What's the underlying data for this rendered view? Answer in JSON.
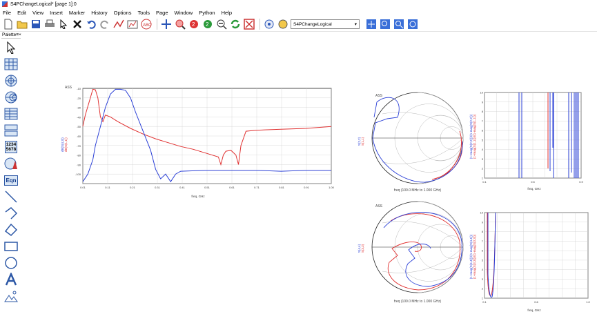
{
  "window": {
    "title": "S4PChangeLogical* [page 1]:0"
  },
  "menu": [
    "File",
    "Edit",
    "View",
    "Insert",
    "Marker",
    "History",
    "Options",
    "Tools",
    "Page",
    "Window",
    "Python",
    "Help"
  ],
  "toolbar": {
    "network_select": "S4PChangeLogical"
  },
  "palette": {
    "title": "Palette",
    "matrix_label_top": "1234",
    "matrix_label_bottom": "5678",
    "eqn_label": "Eqn"
  },
  "plots": {
    "rect1": {
      "ylabel_red": "dB(S(1,1))",
      "ylabel_blue": "dB(S(4,3))",
      "xlabel": "freq, GHz",
      "y_top": "-10",
      "y_ticks": [
        "-10",
        "-20",
        "-30",
        "-40",
        "-50",
        "-60",
        "-70",
        "-80",
        "-90",
        "-100"
      ],
      "x_ticks": [
        "0.01",
        "0.11",
        "0.21",
        "0.31",
        "0.41",
        "0.51",
        "0.61",
        "0.71",
        "0.81",
        "0.91",
        "1.00"
      ],
      "corner": "ASS"
    },
    "smith1": {
      "ylabel_red": "S(1,1)",
      "ylabel_blue": "S(2,2)",
      "caption": "freq (100.0 MHz to 1.000 GHz)",
      "corner": "ASS"
    },
    "smith2": {
      "ylabel_red": "S(3,3)",
      "ylabel_blue": "S(4,4)",
      "caption": "freq (100.0 MHz to 1.000 GHz)",
      "corner": "ASS"
    },
    "vswr1": {
      "ylabel_red": "(1+mag(S(1,1)))/(1-mag(S(1,1)))",
      "ylabel_blue": "(1+mag(S(2,2)))/(1-mag(S(2,2)))",
      "xlabel": "freq, GHz",
      "y_ticks": [
        "10",
        "9",
        "8",
        "7",
        "6",
        "5",
        "4",
        "3",
        "2",
        "1"
      ],
      "x_ticks": [
        "0.1",
        "0.5",
        "0.9"
      ]
    },
    "vswr2": {
      "ylabel_red": "(1+mag(S(3,3)))/(1-mag(S(3,3)))",
      "ylabel_blue": "(1+mag(S(4,4)))/(1-mag(S(4,4)))",
      "xlabel": "freq, GHz",
      "y_ticks": [
        "10",
        "9",
        "8",
        "7",
        "6",
        "5",
        "4",
        "3",
        "2",
        "1"
      ],
      "x_ticks": [
        "0.1",
        "0.6",
        "1.0"
      ]
    }
  },
  "chart_data": [
    {
      "type": "line",
      "title": "",
      "xlabel": "freq, GHz",
      "ylabel": "",
      "xlim": [
        0.01,
        1.0
      ],
      "ylim": [
        -100,
        0
      ],
      "grid": true,
      "series": [
        {
          "name": "dB(S(1,1))",
          "color": "#e03030",
          "x": [
            0.01,
            0.02,
            0.04,
            0.05,
            0.06,
            0.07,
            0.08,
            0.09,
            0.1,
            0.12,
            0.15,
            0.2,
            0.25,
            0.3,
            0.35,
            0.4,
            0.45,
            0.5,
            0.55,
            0.56,
            0.57,
            0.58,
            0.6,
            0.62,
            0.63,
            0.64,
            0.66,
            0.7,
            0.8,
            0.9,
            1.0
          ],
          "y": [
            -40,
            -28,
            -10,
            -1,
            -1.5,
            -10,
            -30,
            -35,
            -28,
            -30,
            -35,
            -42,
            -48,
            -53,
            -57,
            -61,
            -64,
            -68,
            -72,
            -80,
            -70,
            -66,
            -65,
            -70,
            -80,
            -60,
            -45,
            -44,
            -43,
            -42,
            -40
          ]
        },
        {
          "name": "dB(S(4,3))",
          "color": "#2a3fd6",
          "x": [
            0.01,
            0.03,
            0.05,
            0.06,
            0.08,
            0.1,
            0.12,
            0.14,
            0.16,
            0.18,
            0.2,
            0.22,
            0.25,
            0.28,
            0.3,
            0.32,
            0.34,
            0.36,
            0.38,
            0.4,
            0.5,
            0.6,
            0.7,
            0.8,
            0.9,
            1.0
          ],
          "y": [
            -98,
            -90,
            -75,
            -60,
            -40,
            -20,
            -6,
            -1,
            -1,
            -2,
            -10,
            -25,
            -45,
            -65,
            -85,
            -95,
            -90,
            -98,
            -90,
            -87,
            -86,
            -86,
            -86,
            -87,
            -86,
            -86
          ]
        }
      ]
    }
  ]
}
